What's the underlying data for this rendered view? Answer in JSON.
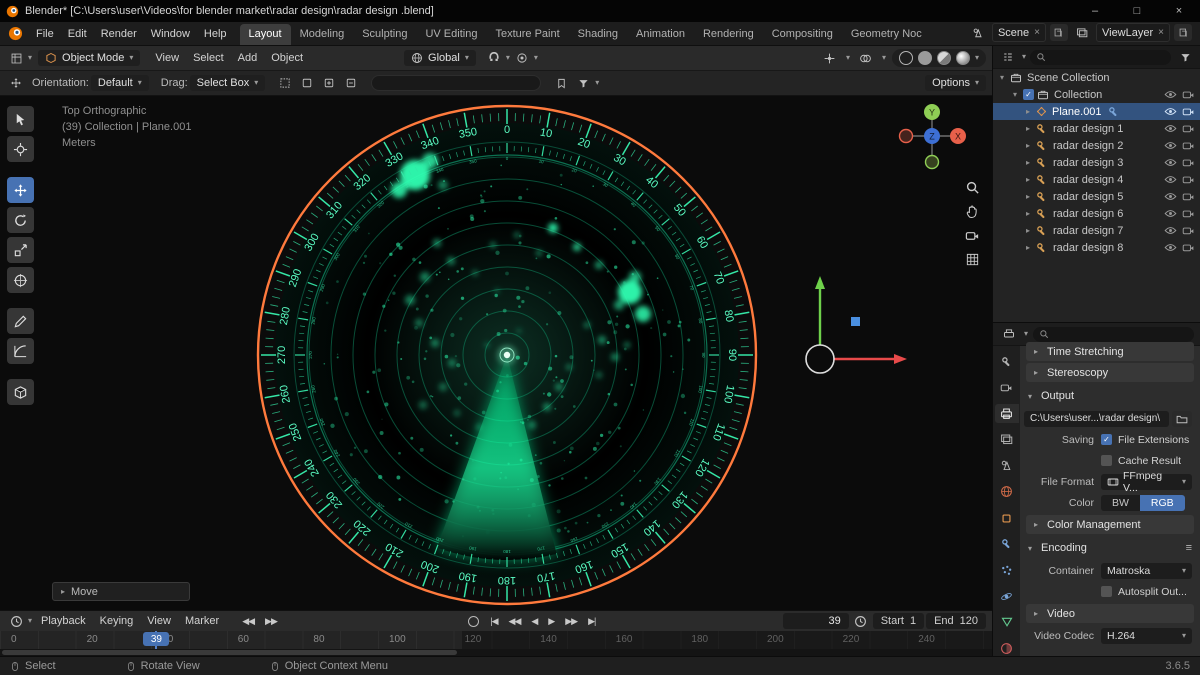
{
  "window": {
    "title": "Blender* [C:\\Users\\user\\Videos\\for blender market\\radar design\\radar design .blend]",
    "minimize": "–",
    "maximize": "□",
    "close": "×"
  },
  "menubar": {
    "menus": [
      "File",
      "Edit",
      "Render",
      "Window",
      "Help"
    ],
    "workspaces": [
      "Layout",
      "Modeling",
      "Sculpting",
      "UV Editing",
      "Texture Paint",
      "Shading",
      "Animation",
      "Rendering",
      "Compositing",
      "Geometry Noc"
    ],
    "active_workspace": "Layout",
    "scene": "Scene",
    "viewlayer": "ViewLayer"
  },
  "toolbar": {
    "mode": "Object Mode",
    "menus": [
      "View",
      "Select",
      "Add",
      "Object"
    ],
    "orientation": "Global"
  },
  "tool_settings": {
    "orientation_label": "Orientation:",
    "orientation_value": "Default",
    "drag_label": "Drag:",
    "drag_value": "Select Box",
    "options_label": "Options"
  },
  "viewport": {
    "info": [
      "Top Orthographic",
      "(39) Collection | Plane.001",
      "Meters"
    ],
    "operator_label": "Move",
    "axis_x": "X",
    "axis_y": "Y",
    "axis_z": "Z"
  },
  "radar": {
    "type": "radar-display",
    "degree_labels": [
      "0",
      "10",
      "20",
      "30",
      "40",
      "50",
      "60",
      "70",
      "80",
      "90",
      "100",
      "110",
      "120",
      "130",
      "140",
      "150",
      "160",
      "170",
      "180",
      "190",
      "200",
      "210",
      "220",
      "230",
      "240",
      "250",
      "260",
      "270",
      "280",
      "290",
      "300",
      "310",
      "320",
      "330",
      "340",
      "350"
    ],
    "label_step_deg": 10,
    "minor_tick_step_deg": 2,
    "ring_count": 9,
    "sweep_start_deg": 166,
    "sweep_end_deg": 200,
    "colors": {
      "outer_ring": "#ff7a3d",
      "ticks": "#35e6a6",
      "labels": "#5cffc5",
      "rings": "#0f8a63",
      "sweep": "#7dffc9",
      "map": "#2effb2"
    }
  },
  "outliner": {
    "search_placeholder": "",
    "rows": [
      {
        "label": "Scene Collection",
        "icon": "scenecol",
        "indent": 0,
        "open": true,
        "right": []
      },
      {
        "label": "Collection",
        "icon": "collection",
        "indent": 1,
        "open": true,
        "checkbox": true,
        "right": [
          "eye",
          "camera"
        ]
      },
      {
        "label": "Plane.001",
        "icon": "plane",
        "indent": 2,
        "selected": true,
        "modifier": true,
        "right": [
          "eye",
          "camera"
        ]
      },
      {
        "label": "radar design 1",
        "icon": "tool",
        "indent": 2,
        "right": [
          "eye",
          "camera"
        ]
      },
      {
        "label": "radar design 2",
        "icon": "tool",
        "indent": 2,
        "right": [
          "eye",
          "camera"
        ]
      },
      {
        "label": "radar design 3",
        "icon": "tool",
        "indent": 2,
        "right": [
          "eye",
          "camera"
        ]
      },
      {
        "label": "radar design 4",
        "icon": "tool",
        "indent": 2,
        "right": [
          "eye",
          "camera"
        ]
      },
      {
        "label": "radar design 5",
        "icon": "tool",
        "indent": 2,
        "right": [
          "eye",
          "camera"
        ]
      },
      {
        "label": "radar design 6",
        "icon": "tool",
        "indent": 2,
        "right": [
          "eye",
          "camera"
        ]
      },
      {
        "label": "radar design 7",
        "icon": "tool",
        "indent": 2,
        "right": [
          "eye",
          "camera"
        ]
      },
      {
        "label": "radar design 8",
        "icon": "tool",
        "indent": 2,
        "right": [
          "eye",
          "camera"
        ]
      }
    ]
  },
  "properties": {
    "search_placeholder": "",
    "rows": [
      {
        "type": "section",
        "label": "Time Stretching",
        "collapsed": true
      },
      {
        "type": "section",
        "label": "Stereoscopy",
        "collapsed": true
      },
      {
        "type": "section",
        "label": "Output",
        "collapsed": false
      },
      {
        "type": "path",
        "value": "C:\\Users\\user...\\radar design\\"
      },
      {
        "type": "check",
        "label": "Saving",
        "check_label": "File Extensions",
        "checked": true
      },
      {
        "type": "check",
        "label": "",
        "check_label": "Cache Result",
        "checked": false
      },
      {
        "type": "dropdown",
        "label": "File Format",
        "value": "FFmpeg V...",
        "icon": "film"
      },
      {
        "type": "segment",
        "label": "Color",
        "options": [
          "BW",
          "RGB"
        ],
        "active": "RGB"
      },
      {
        "type": "section",
        "label": "Color Management",
        "collapsed": true
      },
      {
        "type": "section",
        "label": "Encoding",
        "collapsed": false,
        "preset": true
      },
      {
        "type": "dropdown",
        "label": "Container",
        "value": "Matroska"
      },
      {
        "type": "check",
        "label": "",
        "check_label": "Autosplit Out...",
        "checked": false
      },
      {
        "type": "section",
        "label": "Video",
        "collapsed": true
      },
      {
        "type": "dropdown",
        "label": "Video Codec",
        "value": "H.264"
      }
    ]
  },
  "timeline": {
    "menus": [
      "Playback",
      "Keying",
      "View",
      "Marker"
    ],
    "current_frame": "39",
    "start_label": "Start",
    "start_value": "1",
    "end_label": "End",
    "end_value": "120",
    "ruler": [
      "0",
      "20",
      "40",
      "60",
      "80",
      "100",
      "120",
      "140",
      "160",
      "180",
      "200",
      "220",
      "240"
    ]
  },
  "statusbar": {
    "items": [
      "Select",
      "Rotate View",
      "Object Context Menu"
    ],
    "version": "3.6.5"
  }
}
